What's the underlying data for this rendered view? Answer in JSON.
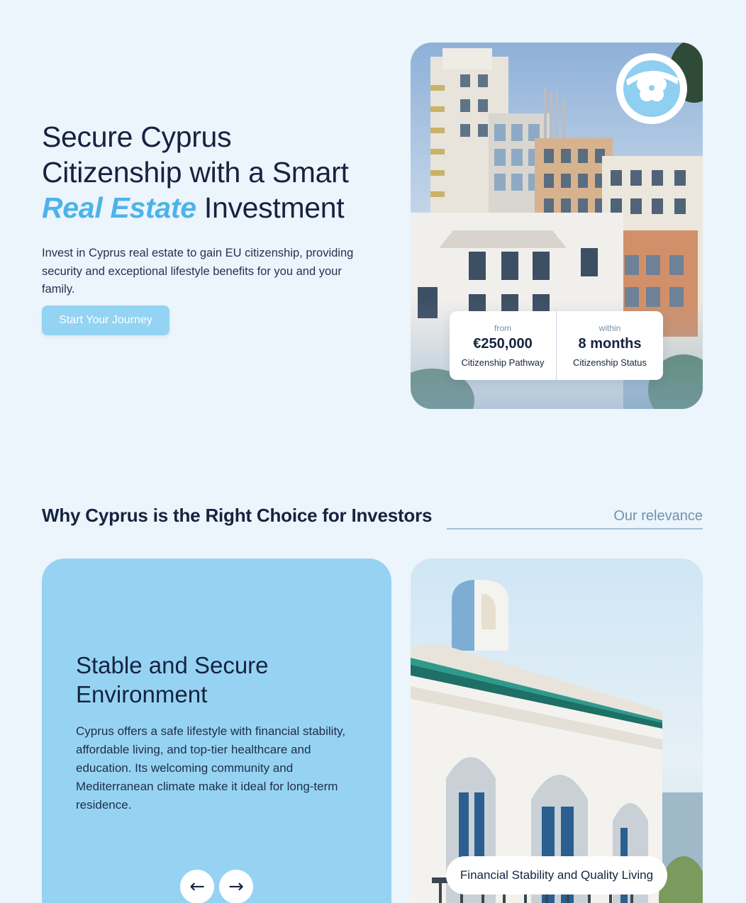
{
  "hero": {
    "title_line1": "Secure Cyprus",
    "title_line2": "Citizenship with a Smart",
    "title_accent": "Real Estate",
    "title_end": "Investment",
    "description": "Invest in Cyprus real estate to gain EU citizenship, providing security and exceptional lifestyle benefits for you and your family.",
    "cta_label": "Start Your Journey",
    "stats": [
      {
        "prefix": "from",
        "value": "€250,000",
        "label": "Citizenship Pathway"
      },
      {
        "prefix": "within",
        "value": "8 months",
        "label": "Citizenship Status"
      }
    ]
  },
  "section": {
    "title": "Why Cyprus is the Right Choice for Investors",
    "tag": "Our relevance"
  },
  "feature": {
    "title": "Stable and Secure Environment",
    "text": "Cyprus offers a safe lifestyle with financial stability, affordable living, and top-tier healthcare and education. Its welcoming community and Mediterranean climate make it ideal for long-term residence.",
    "prev_icon": "←",
    "next_icon": "→",
    "image_caption": "Financial Stability and Quality Living"
  },
  "colors": {
    "background": "#ecf4fc",
    "accent": "#4cb3ea",
    "card_blue": "#96d3f3",
    "text_dark": "#16233f"
  }
}
